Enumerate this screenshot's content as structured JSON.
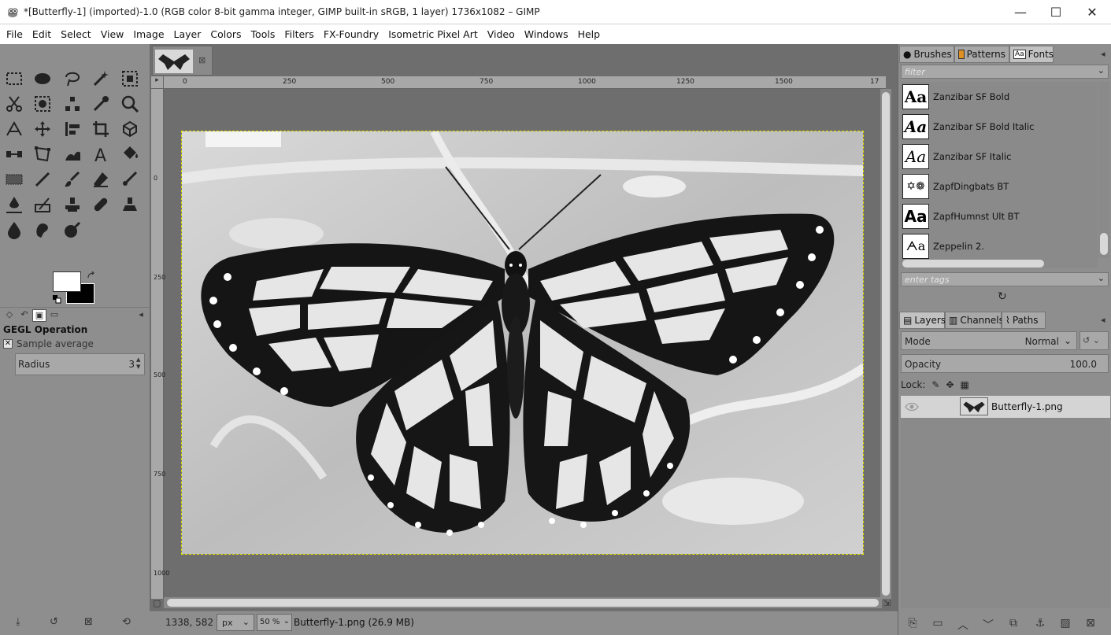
{
  "window": {
    "title": "*[Butterfly-1] (imported)-1.0 (RGB color 8-bit gamma integer, GIMP built-in sRGB, 1 layer) 1736x1082 – GIMP",
    "minimize": "—",
    "maximize": "☐",
    "close": "✕"
  },
  "menu": {
    "items": [
      "File",
      "Edit",
      "Select",
      "View",
      "Image",
      "Layer",
      "Colors",
      "Tools",
      "Filters",
      "FX-Foundry",
      "Isometric Pixel Art",
      "Video",
      "Windows",
      "Help"
    ]
  },
  "tool_options": {
    "title": "GEGL Operation",
    "sample_average_label": "Sample average",
    "radius_label": "Radius",
    "radius_value": "3"
  },
  "canvas": {
    "image_tab_close": "⊠",
    "ruler_top": [
      "0",
      "250",
      "500",
      "750",
      "1000",
      "1250",
      "1500",
      "17"
    ],
    "ruler_left": [
      "0",
      "250",
      "500",
      "750",
      "1000"
    ],
    "photo_label": "Butterfly photo"
  },
  "status": {
    "coords": "1338, 582",
    "unit": "px",
    "zoom": "50 %",
    "file_info": "Butterfly-1.png (26.9 MB)"
  },
  "fonts_panel": {
    "tabs": [
      "Brushes",
      "Patterns",
      "Fonts"
    ],
    "filter_placeholder": "filter",
    "items": [
      {
        "preview": "Aa",
        "name": "Zanzibar SF Bold"
      },
      {
        "preview": "Aa",
        "name": "Zanzibar SF Bold Italic"
      },
      {
        "preview": "Aa",
        "name": "Zanzibar SF Italic"
      },
      {
        "preview": "✡❁",
        "name": "ZapfDingbats BT"
      },
      {
        "preview": "Aa",
        "name": "ZapfHumnst Ult BT"
      },
      {
        "preview": "ᗅa",
        "name": "Zeppelin 2."
      }
    ],
    "tags_placeholder": "enter tags"
  },
  "layers_panel": {
    "tabs": [
      "Layers",
      "Channels",
      "Paths"
    ],
    "mode_label": "Mode",
    "mode_value": "Normal",
    "opacity_label": "Opacity",
    "opacity_value": "100.0",
    "lock_label": "Lock:",
    "layers": [
      {
        "name": "Butterfly-1.png"
      }
    ]
  }
}
